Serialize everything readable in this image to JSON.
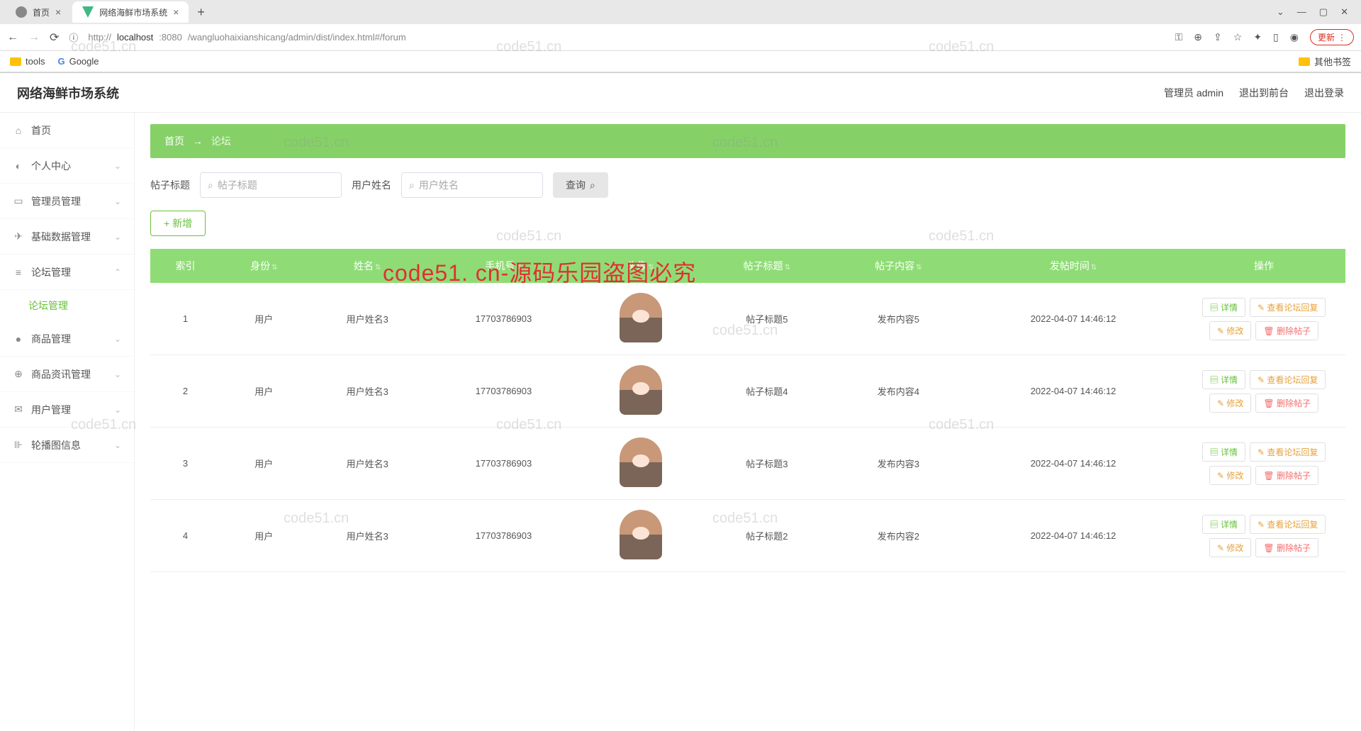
{
  "browser": {
    "tabs": [
      {
        "title": "首页",
        "active": false
      },
      {
        "title": "网络海鲜市场系统",
        "active": true
      }
    ],
    "url_prefix": "http://",
    "url_host": "localhost",
    "url_port": ":8080",
    "url_path": "/wangluohaixianshicang/admin/dist/index.html#/forum",
    "update_label": "更新",
    "bookmarks": {
      "tools": "tools",
      "google": "Google",
      "other": "其他书签"
    }
  },
  "app": {
    "title": "网络海鲜市场系统",
    "header": {
      "admin": "管理员 admin",
      "front": "退出到前台",
      "logout": "退出登录"
    }
  },
  "sidebar": {
    "items": [
      {
        "icon": "⌂",
        "label": "首页",
        "expandable": false
      },
      {
        "icon": "◐",
        "label": "个人中心",
        "expandable": true
      },
      {
        "icon": "▭",
        "label": "管理员管理",
        "expandable": true
      },
      {
        "icon": "✈",
        "label": "基础数据管理",
        "expandable": true
      },
      {
        "icon": "≡",
        "label": "论坛管理",
        "expandable": true,
        "open": true,
        "sub": [
          {
            "label": "论坛管理"
          }
        ]
      },
      {
        "icon": "●",
        "label": "商品管理",
        "expandable": true
      },
      {
        "icon": "⊕",
        "label": "商品资讯管理",
        "expandable": true
      },
      {
        "icon": "✉",
        "label": "用户管理",
        "expandable": true
      },
      {
        "icon": "⊪",
        "label": "轮播图信息",
        "expandable": true
      }
    ]
  },
  "breadcrumb": {
    "home": "首页",
    "sep": "→",
    "current": "论坛"
  },
  "search": {
    "title_label": "帖子标题",
    "title_placeholder": "帖子标题",
    "user_label": "用户姓名",
    "user_placeholder": "用户姓名",
    "query_btn": "查询",
    "add_btn": "新增"
  },
  "table": {
    "headers": [
      "索引",
      "身份",
      "姓名",
      "手机号",
      "头像",
      "帖子标题",
      "帖子内容",
      "发帖时间",
      "操作"
    ],
    "rows": [
      {
        "index": "1",
        "role": "用户",
        "name": "用户姓名3",
        "phone": "17703786903",
        "title": "帖子标题5",
        "content": "发布内容5",
        "time": "2022-04-07 14:46:12"
      },
      {
        "index": "2",
        "role": "用户",
        "name": "用户姓名3",
        "phone": "17703786903",
        "title": "帖子标题4",
        "content": "发布内容4",
        "time": "2022-04-07 14:46:12"
      },
      {
        "index": "3",
        "role": "用户",
        "name": "用户姓名3",
        "phone": "17703786903",
        "title": "帖子标题3",
        "content": "发布内容3",
        "time": "2022-04-07 14:46:12"
      },
      {
        "index": "4",
        "role": "用户",
        "name": "用户姓名3",
        "phone": "17703786903",
        "title": "帖子标题2",
        "content": "发布内容2",
        "time": "2022-04-07 14:46:12"
      }
    ],
    "ops": {
      "detail": "详情",
      "reply": "查看论坛回复",
      "edit": "修改",
      "delete": "删除帖子"
    }
  },
  "overlay": {
    "red_text": "code51. cn-源码乐园盗图必究",
    "wm": "code51.cn"
  }
}
